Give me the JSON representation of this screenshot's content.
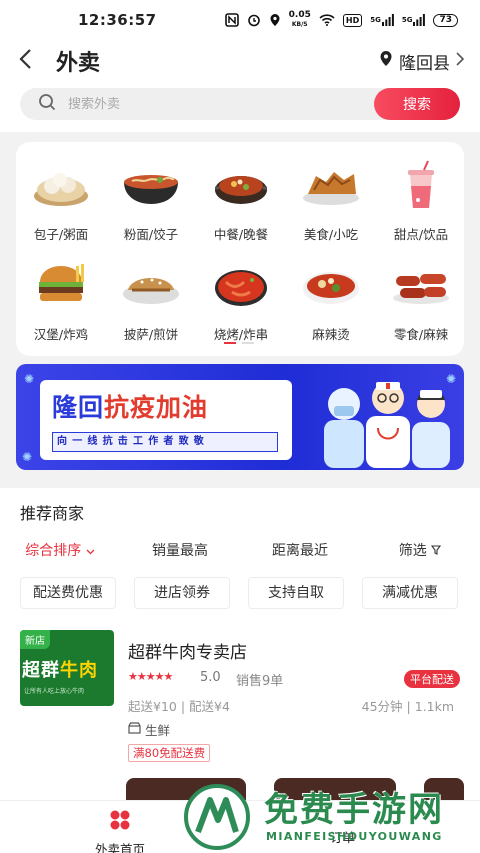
{
  "status_bar": {
    "time": "12:36:57",
    "speed_value": "0.05",
    "speed_unit": "KB/S",
    "hd": "HD",
    "signal1": "5G",
    "signal2": "5G",
    "battery": "73"
  },
  "header": {
    "title": "外卖",
    "location": "隆回县"
  },
  "search": {
    "placeholder": "搜索外卖",
    "button": "搜索"
  },
  "categories": [
    {
      "label": "包子/粥面",
      "icon": "dumpling-icon"
    },
    {
      "label": "粉面/饺子",
      "icon": "noodle-bowl-icon"
    },
    {
      "label": "中餐/晚餐",
      "icon": "hotpot-icon"
    },
    {
      "label": "美食/小吃",
      "icon": "fried-food-icon"
    },
    {
      "label": "甜点/饮品",
      "icon": "drink-cup-icon"
    },
    {
      "label": "汉堡/炸鸡",
      "icon": "burger-icon"
    },
    {
      "label": "披萨/煎饼",
      "icon": "pancake-icon"
    },
    {
      "label": "烧烤/炸串",
      "icon": "crayfish-icon"
    },
    {
      "label": "麻辣烫",
      "icon": "spicy-soup-icon"
    },
    {
      "label": "零食/麻辣",
      "icon": "sausage-icon"
    }
  ],
  "banner": {
    "headline_blue": "隆回",
    "headline_red": "抗疫加油",
    "slogan": "向一线抗击工作者致敬"
  },
  "recommend": {
    "title": "推荐商家",
    "sorts": [
      "综合排序",
      "销量最高",
      "距离最近",
      "筛选"
    ],
    "filters": [
      "配送费优惠",
      "进店领券",
      "支持自取",
      "满减优惠"
    ]
  },
  "shop": {
    "new_tag": "新店",
    "thumb_text_a": "超群",
    "thumb_text_b": "牛肉",
    "thumb_sub": "让所有人吃上放心牛肉",
    "name": "超群牛肉专卖店",
    "stars": "★★★★★",
    "rating": "5.0",
    "sold": "销售9单",
    "platform_tag": "平台配送",
    "fees": "起送¥10 | 配送¥4",
    "eta": "45分钟 | 1.1km",
    "category": "生鲜",
    "promo": "满80免配送费"
  },
  "tabbar": {
    "home": "外卖首页",
    "orders": "订单"
  },
  "watermark": {
    "title": "免费手游网",
    "subtitle": "MIANFEISHOUYOUWANG",
    "letter": "M"
  },
  "colors": {
    "accent": "#e8323f",
    "banner_blue": "#1f2dd6",
    "watermark_green": "#2b8a4e"
  }
}
